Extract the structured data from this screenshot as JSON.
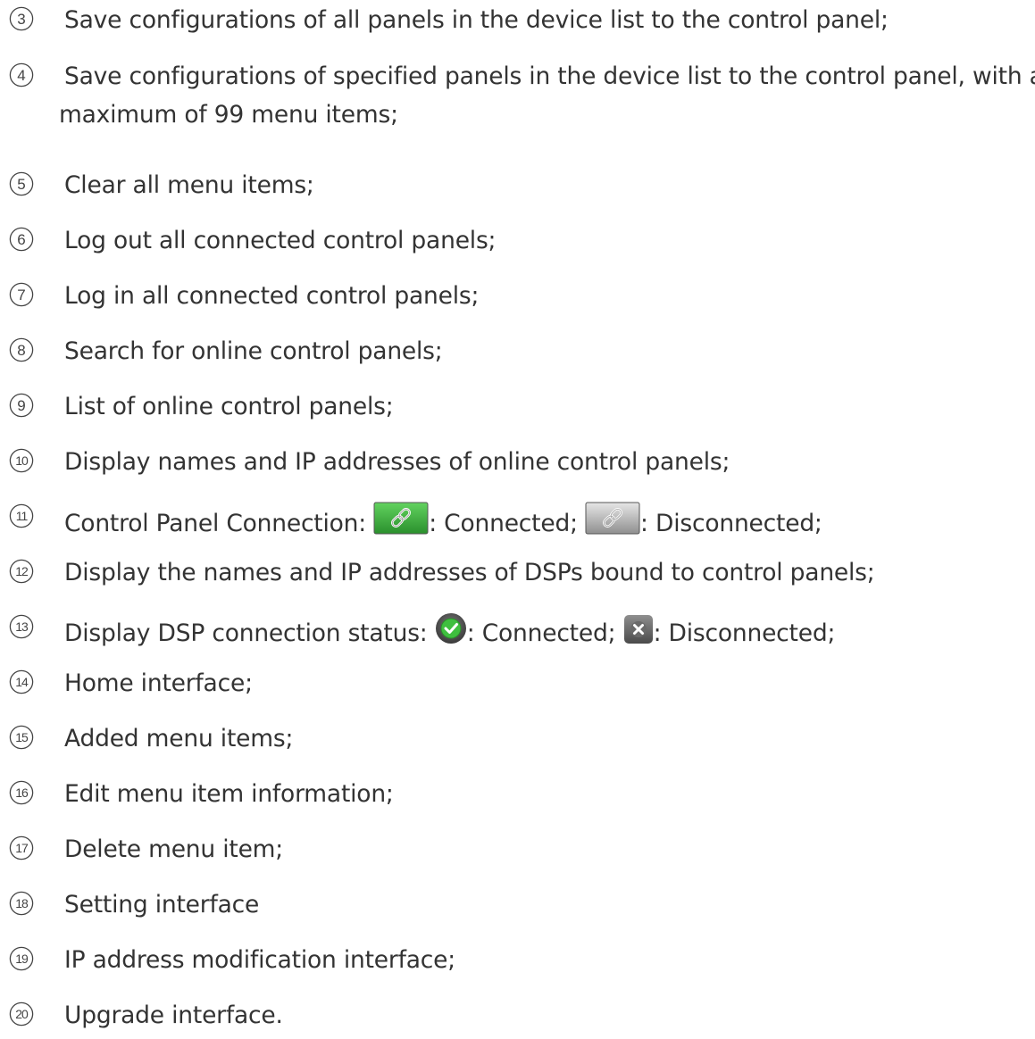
{
  "items": [
    {
      "num": "3",
      "lines": [
        "Save configurations of all panels in the device list to the control panel;"
      ]
    },
    {
      "num": "4",
      "lines": [
        "Save configurations of specified panels in the device list to the control panel, with a",
        "maximum of 99 menu items;"
      ]
    },
    {
      "num": "5",
      "lines": [
        "Clear all menu items;"
      ]
    },
    {
      "num": "6",
      "lines": [
        "Log out all connected control panels;"
      ]
    },
    {
      "num": "7",
      "lines": [
        "Log in all connected control panels;"
      ]
    },
    {
      "num": "8",
      "lines": [
        "Search for online control panels;"
      ]
    },
    {
      "num": "9",
      "lines": [
        "List of online control panels;"
      ]
    },
    {
      "num": "10",
      "lines": [
        "Display names and IP addresses of online control panels;"
      ]
    },
    {
      "num": "11",
      "parts": {
        "before": "Control Panel Connection: ",
        "connected_label": ": Connected; ",
        "disconnected_label": ": Disconnected;"
      },
      "icons": {
        "connected": "green-link-icon",
        "disconnected": "grey-link-icon"
      }
    },
    {
      "num": "12",
      "lines": [
        "Display the names and IP addresses of DSPs bound to control panels;"
      ]
    },
    {
      "num": "13",
      "parts": {
        "before": "Display DSP connection status: ",
        "connected_label": ": Connected; ",
        "disconnected_label": ": Disconnected;"
      },
      "icons": {
        "connected": "green-check-icon",
        "disconnected": "grey-x-icon"
      }
    },
    {
      "num": "14",
      "lines": [
        "Home interface;"
      ]
    },
    {
      "num": "15",
      "lines": [
        "Added menu items;"
      ]
    },
    {
      "num": "16",
      "lines": [
        "Edit menu item information;"
      ]
    },
    {
      "num": "17",
      "lines": [
        "Delete menu item;"
      ]
    },
    {
      "num": "18",
      "lines": [
        "Setting interface"
      ]
    },
    {
      "num": "19",
      "lines": [
        "IP address modification interface;"
      ]
    },
    {
      "num": "20",
      "lines": [
        "Upgrade interface."
      ]
    }
  ],
  "colors": {
    "text": "#333333",
    "circle_number": "#444444",
    "connected_green": "#3cb043",
    "disconnected_grey": "#8a8a8a"
  }
}
